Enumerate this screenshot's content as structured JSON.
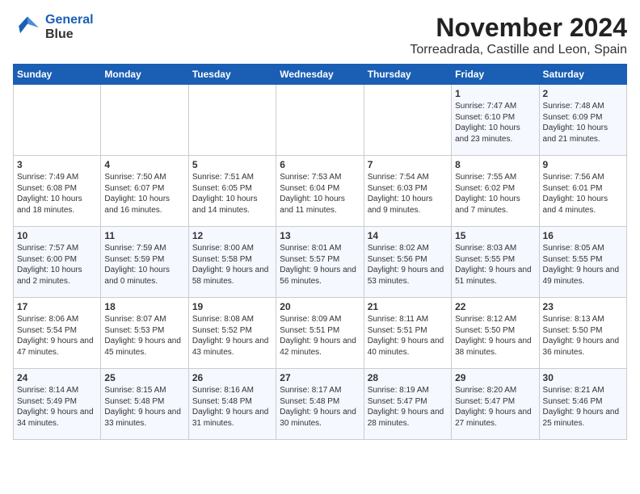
{
  "logo": {
    "line1": "General",
    "line2": "Blue"
  },
  "title": "November 2024",
  "subtitle": "Torreadrada, Castille and Leon, Spain",
  "days_of_week": [
    "Sunday",
    "Monday",
    "Tuesday",
    "Wednesday",
    "Thursday",
    "Friday",
    "Saturday"
  ],
  "weeks": [
    [
      {
        "day": "",
        "info": ""
      },
      {
        "day": "",
        "info": ""
      },
      {
        "day": "",
        "info": ""
      },
      {
        "day": "",
        "info": ""
      },
      {
        "day": "",
        "info": ""
      },
      {
        "day": "1",
        "info": "Sunrise: 7:47 AM\nSunset: 6:10 PM\nDaylight: 10 hours and 23 minutes."
      },
      {
        "day": "2",
        "info": "Sunrise: 7:48 AM\nSunset: 6:09 PM\nDaylight: 10 hours and 21 minutes."
      }
    ],
    [
      {
        "day": "3",
        "info": "Sunrise: 7:49 AM\nSunset: 6:08 PM\nDaylight: 10 hours and 18 minutes."
      },
      {
        "day": "4",
        "info": "Sunrise: 7:50 AM\nSunset: 6:07 PM\nDaylight: 10 hours and 16 minutes."
      },
      {
        "day": "5",
        "info": "Sunrise: 7:51 AM\nSunset: 6:05 PM\nDaylight: 10 hours and 14 minutes."
      },
      {
        "day": "6",
        "info": "Sunrise: 7:53 AM\nSunset: 6:04 PM\nDaylight: 10 hours and 11 minutes."
      },
      {
        "day": "7",
        "info": "Sunrise: 7:54 AM\nSunset: 6:03 PM\nDaylight: 10 hours and 9 minutes."
      },
      {
        "day": "8",
        "info": "Sunrise: 7:55 AM\nSunset: 6:02 PM\nDaylight: 10 hours and 7 minutes."
      },
      {
        "day": "9",
        "info": "Sunrise: 7:56 AM\nSunset: 6:01 PM\nDaylight: 10 hours and 4 minutes."
      }
    ],
    [
      {
        "day": "10",
        "info": "Sunrise: 7:57 AM\nSunset: 6:00 PM\nDaylight: 10 hours and 2 minutes."
      },
      {
        "day": "11",
        "info": "Sunrise: 7:59 AM\nSunset: 5:59 PM\nDaylight: 10 hours and 0 minutes."
      },
      {
        "day": "12",
        "info": "Sunrise: 8:00 AM\nSunset: 5:58 PM\nDaylight: 9 hours and 58 minutes."
      },
      {
        "day": "13",
        "info": "Sunrise: 8:01 AM\nSunset: 5:57 PM\nDaylight: 9 hours and 56 minutes."
      },
      {
        "day": "14",
        "info": "Sunrise: 8:02 AM\nSunset: 5:56 PM\nDaylight: 9 hours and 53 minutes."
      },
      {
        "day": "15",
        "info": "Sunrise: 8:03 AM\nSunset: 5:55 PM\nDaylight: 9 hours and 51 minutes."
      },
      {
        "day": "16",
        "info": "Sunrise: 8:05 AM\nSunset: 5:55 PM\nDaylight: 9 hours and 49 minutes."
      }
    ],
    [
      {
        "day": "17",
        "info": "Sunrise: 8:06 AM\nSunset: 5:54 PM\nDaylight: 9 hours and 47 minutes."
      },
      {
        "day": "18",
        "info": "Sunrise: 8:07 AM\nSunset: 5:53 PM\nDaylight: 9 hours and 45 minutes."
      },
      {
        "day": "19",
        "info": "Sunrise: 8:08 AM\nSunset: 5:52 PM\nDaylight: 9 hours and 43 minutes."
      },
      {
        "day": "20",
        "info": "Sunrise: 8:09 AM\nSunset: 5:51 PM\nDaylight: 9 hours and 42 minutes."
      },
      {
        "day": "21",
        "info": "Sunrise: 8:11 AM\nSunset: 5:51 PM\nDaylight: 9 hours and 40 minutes."
      },
      {
        "day": "22",
        "info": "Sunrise: 8:12 AM\nSunset: 5:50 PM\nDaylight: 9 hours and 38 minutes."
      },
      {
        "day": "23",
        "info": "Sunrise: 8:13 AM\nSunset: 5:50 PM\nDaylight: 9 hours and 36 minutes."
      }
    ],
    [
      {
        "day": "24",
        "info": "Sunrise: 8:14 AM\nSunset: 5:49 PM\nDaylight: 9 hours and 34 minutes."
      },
      {
        "day": "25",
        "info": "Sunrise: 8:15 AM\nSunset: 5:48 PM\nDaylight: 9 hours and 33 minutes."
      },
      {
        "day": "26",
        "info": "Sunrise: 8:16 AM\nSunset: 5:48 PM\nDaylight: 9 hours and 31 minutes."
      },
      {
        "day": "27",
        "info": "Sunrise: 8:17 AM\nSunset: 5:48 PM\nDaylight: 9 hours and 30 minutes."
      },
      {
        "day": "28",
        "info": "Sunrise: 8:19 AM\nSunset: 5:47 PM\nDaylight: 9 hours and 28 minutes."
      },
      {
        "day": "29",
        "info": "Sunrise: 8:20 AM\nSunset: 5:47 PM\nDaylight: 9 hours and 27 minutes."
      },
      {
        "day": "30",
        "info": "Sunrise: 8:21 AM\nSunset: 5:46 PM\nDaylight: 9 hours and 25 minutes."
      }
    ]
  ]
}
